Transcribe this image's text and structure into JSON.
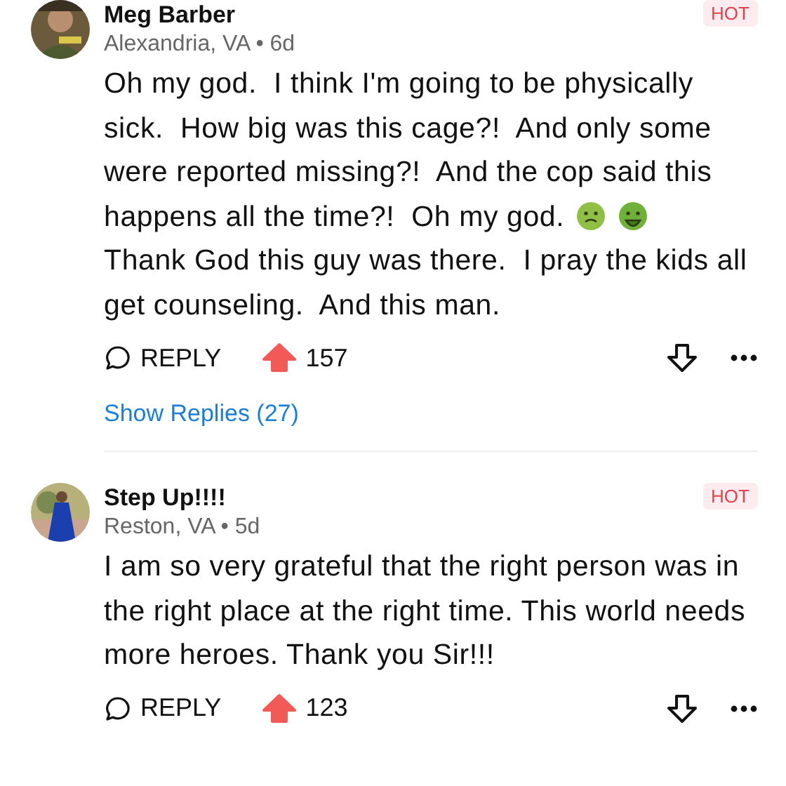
{
  "comments": [
    {
      "author": "Meg Barber",
      "badge": "HOT",
      "meta": "Alexandria, VA • 6d",
      "lines": [
        {
          "text": "Oh my god.  I think I'm going to be physically"
        },
        {
          "text": "sick.  How big was this cage?!  And only some"
        },
        {
          "text": "were reported missing?!  And the cop said this"
        },
        {
          "text": "happens all the time?!  Oh my god.",
          "emojis": [
            {
              "kind": "nauseated"
            },
            {
              "kind": "vomiting"
            }
          ]
        },
        {
          "text": "Thank God this guy was there.  I pray the kids all"
        },
        {
          "text": "get counseling.  And this man."
        }
      ],
      "reply_label": "REPLY",
      "upvoted": true,
      "votes": "157",
      "show_replies": "Show Replies (27)"
    },
    {
      "author": "Step Up!!!!",
      "badge": "HOT",
      "meta": "Reston, VA • 5d",
      "lines": [
        {
          "text": "I am so very grateful that the right person was in"
        },
        {
          "text": "the right place at the right time. This world needs"
        },
        {
          "text": "more heroes. Thank you Sir!!!"
        }
      ],
      "reply_label": "REPLY",
      "upvoted": true,
      "votes": "123"
    }
  ]
}
